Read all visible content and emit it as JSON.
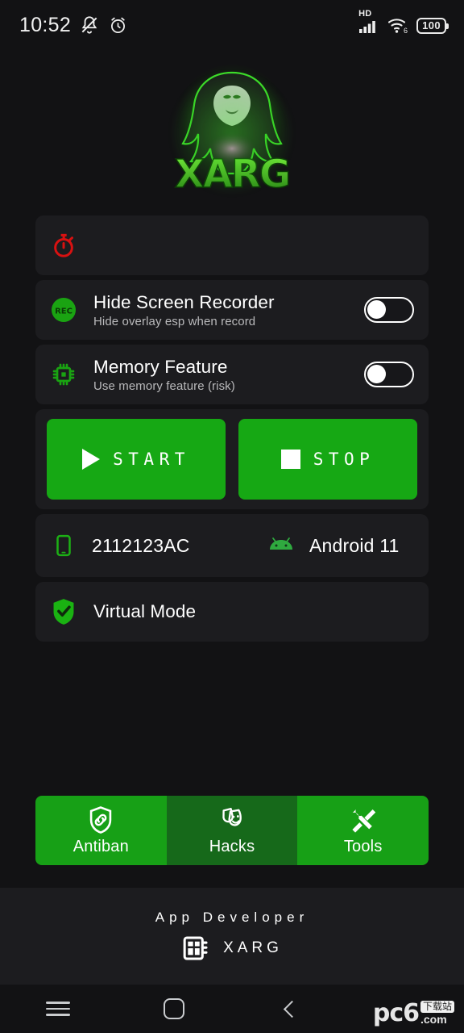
{
  "statusbar": {
    "time": "10:52",
    "icons_left": [
      "mute-icon",
      "alarm-icon"
    ],
    "network_label": "HD",
    "wifi_label": "6",
    "battery_level": "100"
  },
  "logo": {
    "name": "xarg-logo",
    "wordmark": "XARG"
  },
  "timer_card": {
    "icon": "stopwatch-icon",
    "icon_color": "#d81111",
    "label": ""
  },
  "settings": [
    {
      "icon": "rec-icon",
      "icon_text": "REC",
      "title": "Hide Screen Recorder",
      "subtitle": "Hide overlay esp when record",
      "toggle_on": false
    },
    {
      "icon": "memory-chip-icon",
      "title": "Memory Feature",
      "subtitle": "Use memory feature (risk)",
      "toggle_on": false
    }
  ],
  "actions": {
    "start_label": "START",
    "stop_label": "STOP",
    "button_color": "#16a814"
  },
  "device": {
    "phone_icon": "phone-icon",
    "model": "2112123AC",
    "os_icon": "android-icon",
    "os": "Android 11"
  },
  "virtual_mode": {
    "icon": "shield-check-icon",
    "label": "Virtual Mode"
  },
  "tabs": [
    {
      "icon": "shield-link-icon",
      "label": "Antiban",
      "selected": false
    },
    {
      "icon": "masks-icon",
      "label": "Hacks",
      "selected": true
    },
    {
      "icon": "tools-icon",
      "label": "Tools",
      "selected": false
    }
  ],
  "footer": {
    "developer_label": "App Developer",
    "developer_name": "XARG",
    "icon": "chip-board-icon"
  },
  "navbar": {
    "recents": "menu-icon",
    "home": "home-icon",
    "back": "back-icon"
  },
  "watermark": {
    "brand": "pc6",
    "cn": "下载站",
    "domain": ".com"
  }
}
